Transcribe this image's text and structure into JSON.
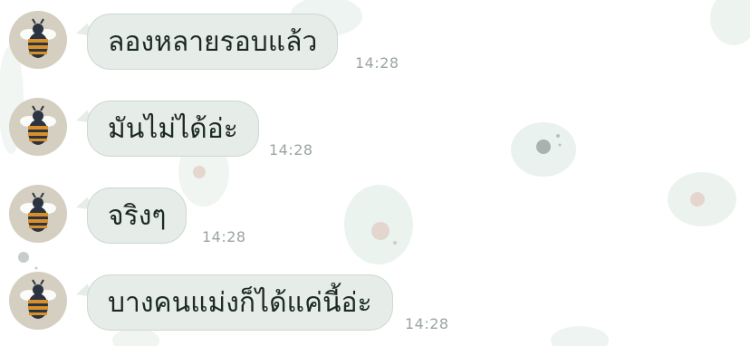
{
  "chat": {
    "messages": [
      {
        "text": "ลองหลายรอบแล้ว",
        "time": "14:28"
      },
      {
        "text": "มันไม่ได้อ่ะ",
        "time": "14:28"
      },
      {
        "text": "จริงๆ",
        "time": "14:28"
      },
      {
        "text": "บางคนแม่งก็ได้แค่นี้อ่ะ",
        "time": "14:28"
      }
    ]
  },
  "colors": {
    "bubble": "#e6ece7",
    "bubble_border": "#cdd8d0",
    "avatar_bg": "#d4cfc0",
    "time_text": "#9aa5a0",
    "bee_stripe": "#d9902a"
  },
  "icons": {
    "avatar": "bee-icon"
  }
}
